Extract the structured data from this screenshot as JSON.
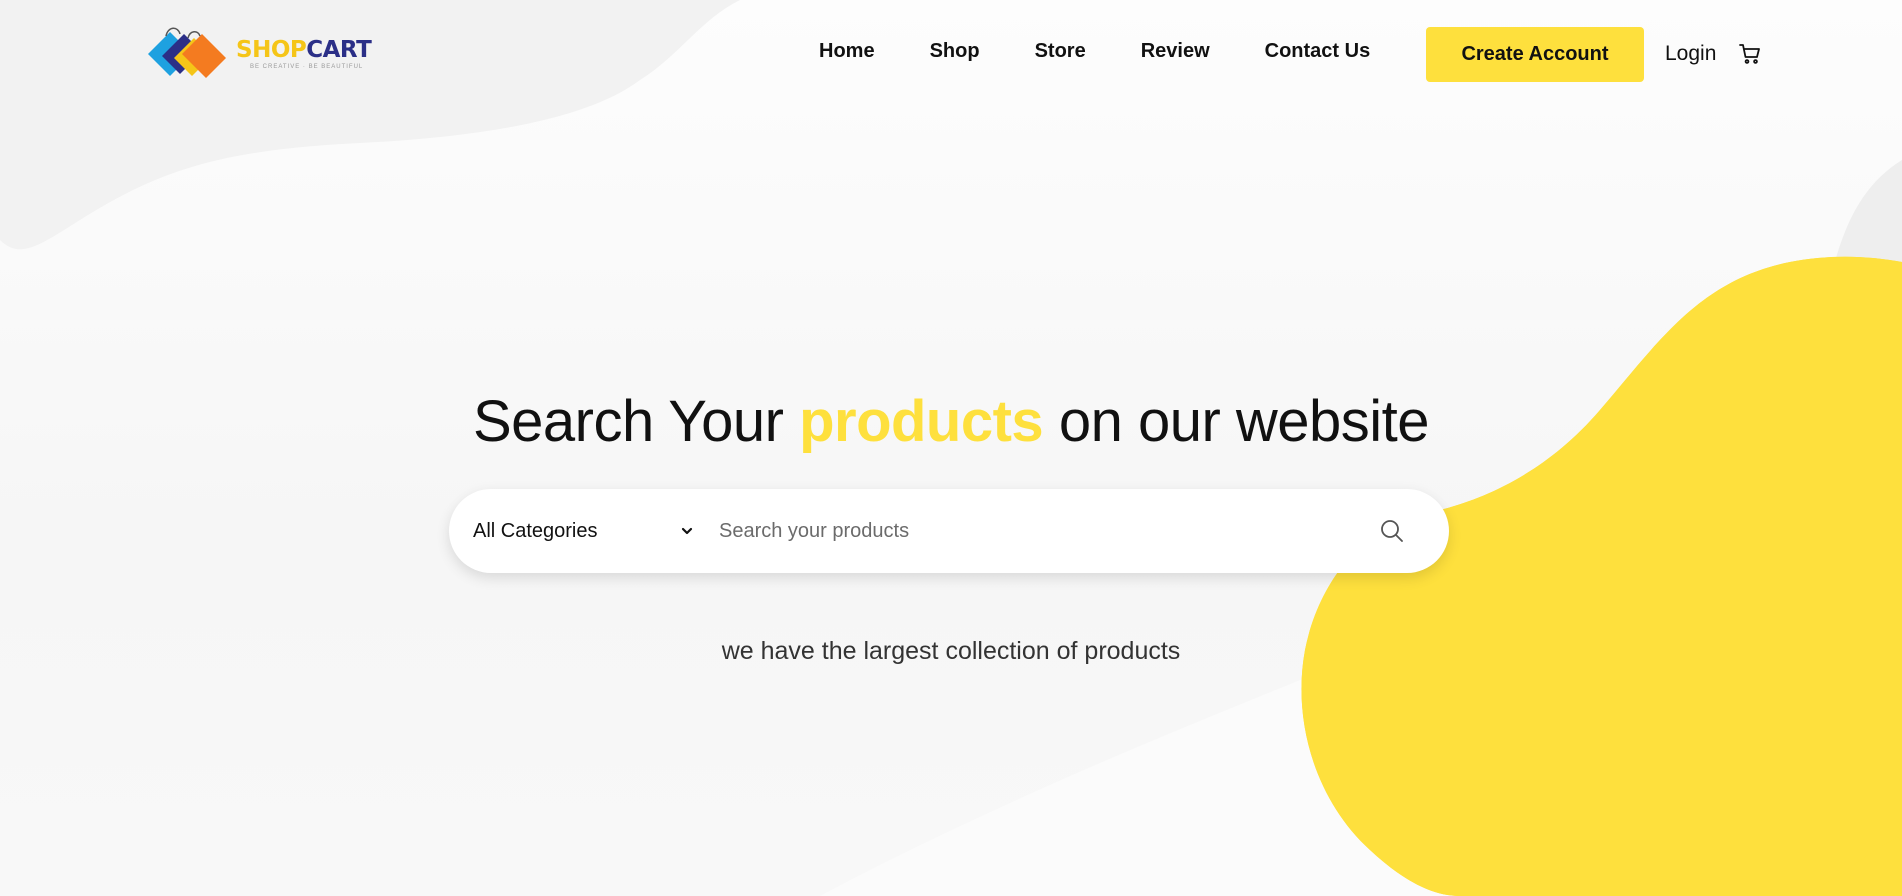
{
  "brand": {
    "name_part1": "SHOP",
    "name_part2": "CART",
    "tagline": "BE CREATIVE · BE BEAUTIFUL"
  },
  "nav": {
    "items": [
      {
        "label": "Home"
      },
      {
        "label": "Shop"
      },
      {
        "label": "Store"
      },
      {
        "label": "Review"
      },
      {
        "label": "Contact Us"
      }
    ],
    "create_account_label": "Create Account",
    "login_label": "Login",
    "cart_icon": "cart-icon"
  },
  "hero": {
    "title_before": "Search Your ",
    "title_accent": "products",
    "title_after": " on our website",
    "tagline": "we have the largest collection of products"
  },
  "search": {
    "category_selected": "All Categories",
    "placeholder": "Search your products",
    "value": ""
  },
  "colors": {
    "accent_yellow": "#fee03d",
    "brand_blue": "#2b2f87",
    "brand_orange": "#f47b20",
    "brand_cyan": "#1ea1e0",
    "background": "#f7f7f7"
  }
}
